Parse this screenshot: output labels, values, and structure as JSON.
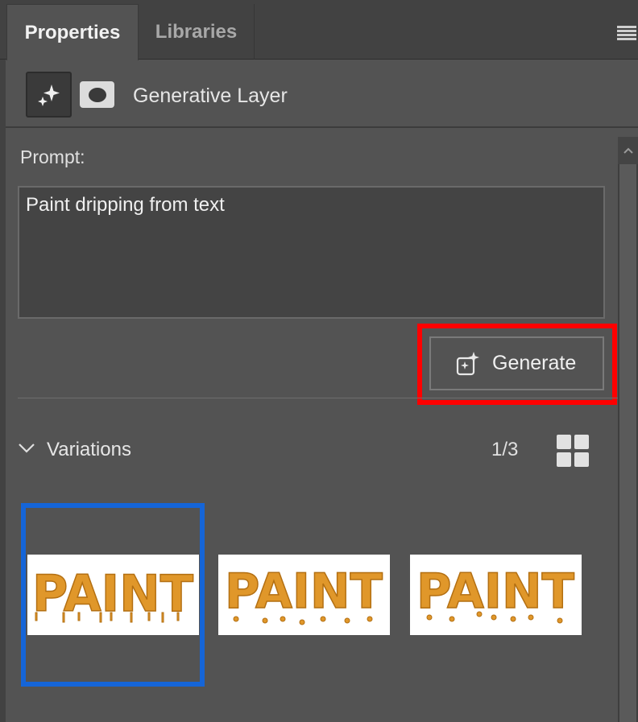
{
  "tabs": [
    {
      "label": "Properties",
      "active": true
    },
    {
      "label": "Libraries",
      "active": false
    }
  ],
  "panel_menu_icon": "hamburger-icon",
  "layer": {
    "title": "Generative Layer",
    "icon": "sparkle-icon",
    "mask_icon": "layer-mask-icon"
  },
  "prompt": {
    "label": "Prompt:",
    "value": "Paint dripping from text"
  },
  "generate_button": {
    "label": "Generate",
    "icon": "generate-sparkle-icon",
    "highlight_color": "#ff0000"
  },
  "variations": {
    "label": "Variations",
    "count": "1/3",
    "selected_index": 0,
    "selection_color": "#1565d8",
    "items": [
      {
        "text": "PAINT"
      },
      {
        "text": "PAINT"
      },
      {
        "text": "PAINT"
      }
    ]
  },
  "colors": {
    "panel_bg": "#535353",
    "tab_bar_bg": "#424242",
    "paint_orange": "#e0972a"
  }
}
